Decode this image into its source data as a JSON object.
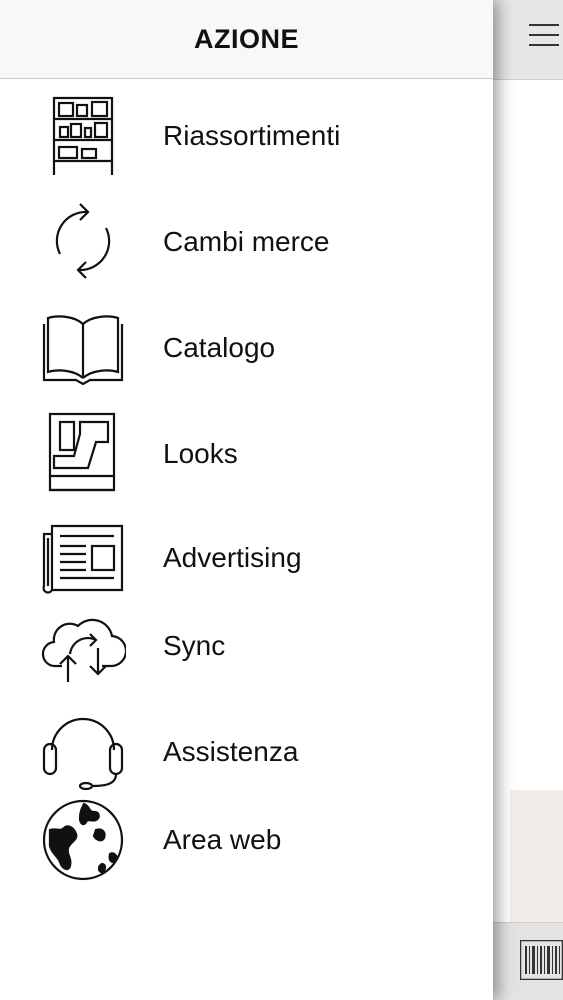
{
  "drawer": {
    "title": "AZIONE",
    "items": [
      {
        "label": "Riassortimenti",
        "icon": "shelf-icon"
      },
      {
        "label": "Cambi merce",
        "icon": "refresh-icon"
      },
      {
        "label": "Catalogo",
        "icon": "open-book-icon"
      },
      {
        "label": "Looks",
        "icon": "looks-icon"
      },
      {
        "label": "Advertising",
        "icon": "newspaper-icon"
      },
      {
        "label": "Sync",
        "icon": "cloud-sync-icon"
      },
      {
        "label": "Assistenza",
        "icon": "headset-icon"
      },
      {
        "label": "Area web",
        "icon": "globe-icon"
      }
    ]
  },
  "background": {
    "menu_icon": "hamburger-icon",
    "footer_icon": "barcode-icon"
  },
  "colors": {
    "text": "#111111",
    "header_bg": "#f8f8f8",
    "drawer_bg": "#ffffff"
  }
}
